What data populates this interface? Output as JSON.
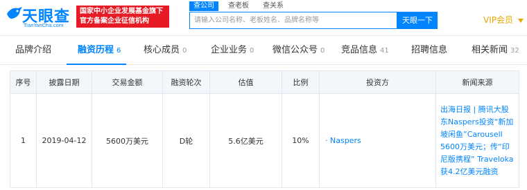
{
  "header": {
    "logo_cn": "天眼查",
    "logo_en": "TianYanCha.com",
    "promo_line1": "国家中小企业发展基金旗下",
    "promo_line2": "官方备案企业征信机构",
    "search_tabs": [
      "查公司",
      "查老板",
      "查关系"
    ],
    "search_placeholder": "请输入公司名称、老板姓名、品牌名称等",
    "search_button": "天眼一下",
    "vip_label": "VIP会员"
  },
  "tabs": [
    {
      "label": "品牌介绍",
      "count": ""
    },
    {
      "label": "融资历程",
      "count": "6"
    },
    {
      "label": "核心成员",
      "count": "0"
    },
    {
      "label": "企业业务",
      "count": "0"
    },
    {
      "label": "微信公众号",
      "count": "0"
    },
    {
      "label": "竞品信息",
      "count": "41"
    },
    {
      "label": "招聘信息",
      "count": ""
    },
    {
      "label": "相关新闻",
      "count": "32"
    }
  ],
  "table": {
    "headers": [
      "序号",
      "披露日期",
      "交易金额",
      "融资轮次",
      "估值",
      "比例",
      "投资方",
      "新闻来源"
    ],
    "rows": [
      {
        "index": "1",
        "date": "2019-04-12",
        "amount": "5600万美元",
        "round": "D轮",
        "valuation": "5.6亿美元",
        "ratio": "10%",
        "investor": "· Naspers",
        "news": "出海日报 | 腾讯大股东Naspers投资“新加坡闲鱼”Carousell 5600万美元；传“印尼版携程” Traveloka 获4.2亿美元融资"
      }
    ]
  },
  "colors": {
    "brand_blue": "#0084ff",
    "promo_red": "#e61b25",
    "vip_gold": "#e7a600"
  }
}
